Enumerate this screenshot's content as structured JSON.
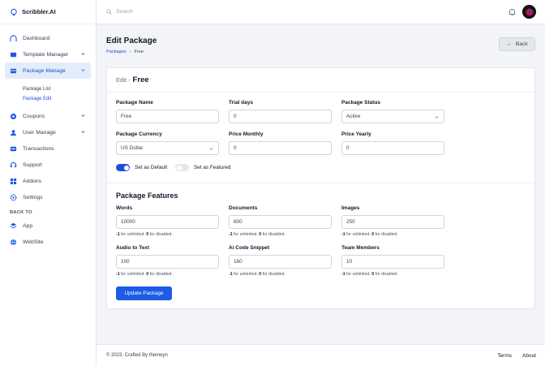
{
  "brand": {
    "name": "Scribbler.AI"
  },
  "sidebar": {
    "items": [
      {
        "label": "Dashboard",
        "icon": "dashboard-icon"
      },
      {
        "label": "Template Manager",
        "icon": "template-icon"
      },
      {
        "label": "Package Manage",
        "icon": "package-icon"
      },
      {
        "label": "Coupons",
        "icon": "coupon-icon"
      },
      {
        "label": "User Manage",
        "icon": "user-icon"
      },
      {
        "label": "Transactions",
        "icon": "transactions-icon"
      },
      {
        "label": "Support",
        "icon": "support-icon"
      },
      {
        "label": "Addons",
        "icon": "addons-icon"
      },
      {
        "label": "Settings",
        "icon": "settings-icon"
      }
    ],
    "sub_items": [
      {
        "label": "Package List"
      },
      {
        "label": "Package Edit"
      }
    ],
    "back_label": "BACK TO",
    "back_items": [
      {
        "label": "App",
        "icon": "app-icon"
      },
      {
        "label": "WebSite",
        "icon": "globe-icon"
      }
    ]
  },
  "topbar": {
    "search_placeholder": "Search"
  },
  "page": {
    "title": "Edit Package",
    "breadcrumb": [
      "Packages",
      "Free"
    ],
    "back_label": "Back"
  },
  "card": {
    "pre": "Edit -",
    "name": "Free",
    "fields": {
      "package_name": {
        "label": "Package Name",
        "value": "Free"
      },
      "trial_days": {
        "label": "Trial days",
        "value": "0"
      },
      "package_status": {
        "label": "Package Status",
        "value": "Active"
      },
      "package_currency": {
        "label": "Package Currency",
        "value": "US Dollar"
      },
      "price_monthly": {
        "label": "Price Monthly",
        "value": "0"
      },
      "price_yearly": {
        "label": "Price Yearly",
        "value": "0"
      }
    },
    "toggles": {
      "default": {
        "label": "Set as Default",
        "on": true
      },
      "featured": {
        "label": "Set as Featured",
        "on": false
      }
    },
    "features_title": "Package Features",
    "features": {
      "words": {
        "label": "Words",
        "value": "10000"
      },
      "documents": {
        "label": "Documents",
        "value": "600"
      },
      "images": {
        "label": "Images",
        "value": "250"
      },
      "audio": {
        "label": "Audio to Text",
        "value": "100"
      },
      "code": {
        "label": "Ai Code Snippet",
        "value": "160"
      },
      "team": {
        "label": "Team Members",
        "value": "10"
      }
    },
    "hint": {
      "a": "-1",
      "b": "for unlimited.",
      "c": "0",
      "d": "for disabled."
    },
    "update_label": "Update Package"
  },
  "footer": {
    "copy": "© 2023. Crafted By themeyn",
    "terms": "Terms",
    "about": "About"
  },
  "colors": {
    "accent": "#1d5ae6",
    "active_bg": "#e3ecfb"
  }
}
